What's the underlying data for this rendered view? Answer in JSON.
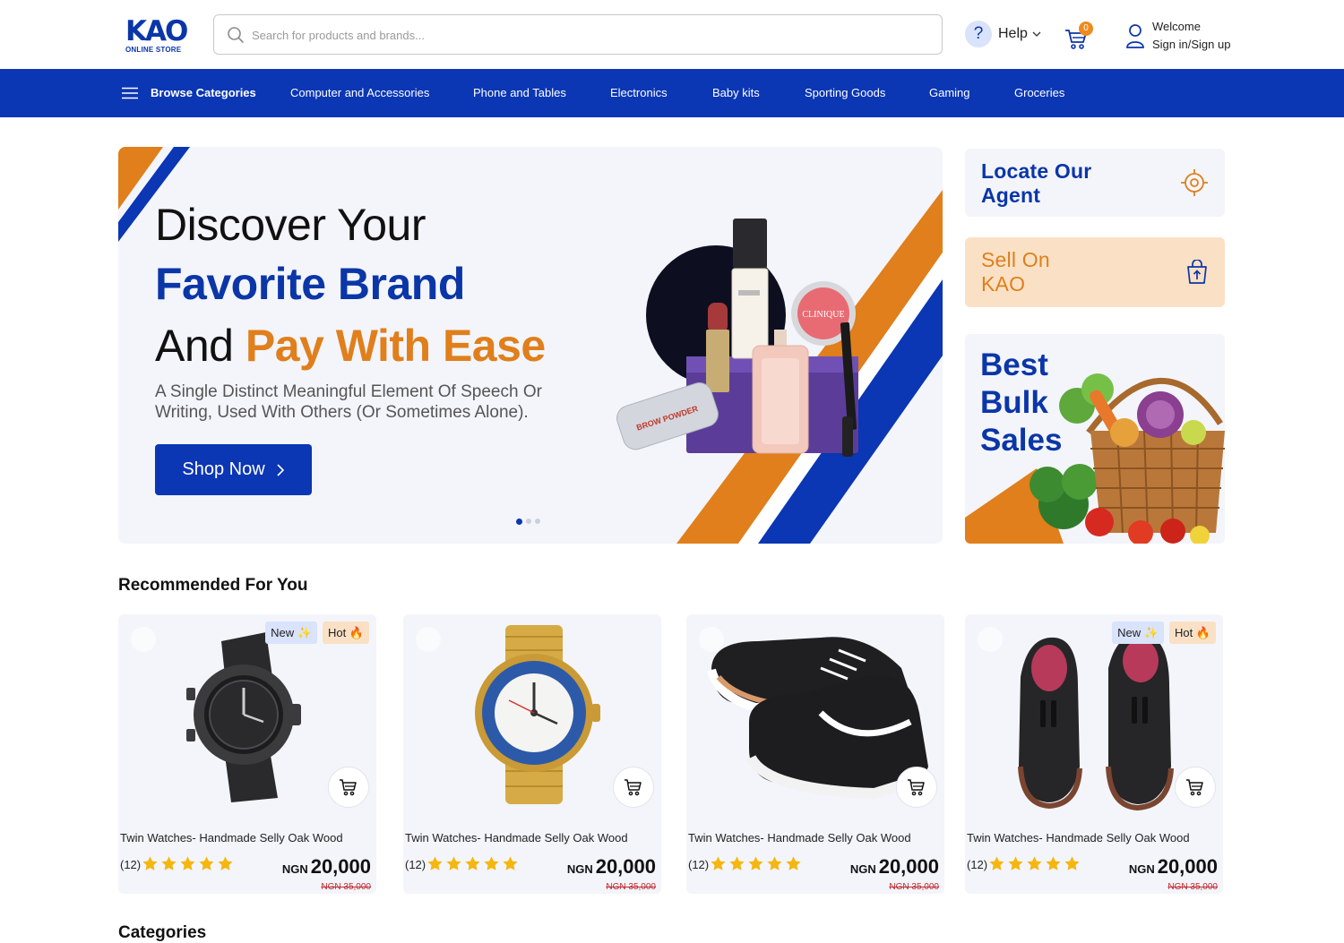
{
  "brand": {
    "logo_text": "KAO",
    "logo_sub": "ONLINE STORE",
    "primary": "#0b36b4",
    "accent": "#e07f1b"
  },
  "header": {
    "search_placeholder": "Search for products and brands...",
    "help_label": "Help",
    "cart_count": "0",
    "welcome": "Welcome",
    "signin": "Sign in/Sign up"
  },
  "nav": {
    "browse": "Browse Categories",
    "items": [
      "Computer and Accessories",
      "Phone and Tables",
      "Electronics",
      "Baby kits",
      "Sporting Goods",
      "Gaming",
      "Groceries"
    ]
  },
  "hero": {
    "line1": "Discover Your",
    "line2": "Favorite Brand",
    "line3_plain": "And ",
    "line3_accent": "Pay With Ease",
    "subtitle": "A Single Distinct Meaningful Element Of Speech Or Writing, Used With Others (Or Sometimes Alone).",
    "cta": "Shop Now",
    "slides": 3,
    "active_slide": 1,
    "product_labels": {
      "blush": "CLINIQUE",
      "brow": "BROW POWDER"
    }
  },
  "promos": {
    "locate": "Locate Our Agent",
    "sell": "Sell On KAO",
    "bulk": "Best Bulk Sales"
  },
  "recommended": {
    "title": "Recommended For You",
    "products": [
      {
        "name": "Twin Watches- Handmade Selly Oak Wood",
        "reviews": "(12)",
        "rating": 5,
        "currency": "NGN",
        "price": "20,000",
        "old_price": "NGN 35,000",
        "badge_new": "New ✨",
        "badge_hot": "Hot 🔥",
        "image": "black-watch"
      },
      {
        "name": "Twin Watches- Handmade Selly Oak Wood",
        "reviews": "(12)",
        "rating": 5,
        "currency": "NGN",
        "price": "20,000",
        "old_price": "NGN 35,000",
        "badge_new": "",
        "badge_hot": "",
        "image": "gold-watch"
      },
      {
        "name": "Twin Watches- Handmade Selly Oak Wood",
        "reviews": "(12)",
        "rating": 5,
        "currency": "NGN",
        "price": "20,000",
        "old_price": "NGN 35,000",
        "badge_new": "",
        "badge_hot": "",
        "image": "sneakers"
      },
      {
        "name": "Twin Watches- Handmade Selly Oak Wood",
        "reviews": "(12)",
        "rating": 5,
        "currency": "NGN",
        "price": "20,000",
        "old_price": "NGN 35,000",
        "badge_new": "New ✨",
        "badge_hot": "Hot 🔥",
        "image": "loafers"
      }
    ]
  },
  "categories": {
    "title": "Categories"
  }
}
